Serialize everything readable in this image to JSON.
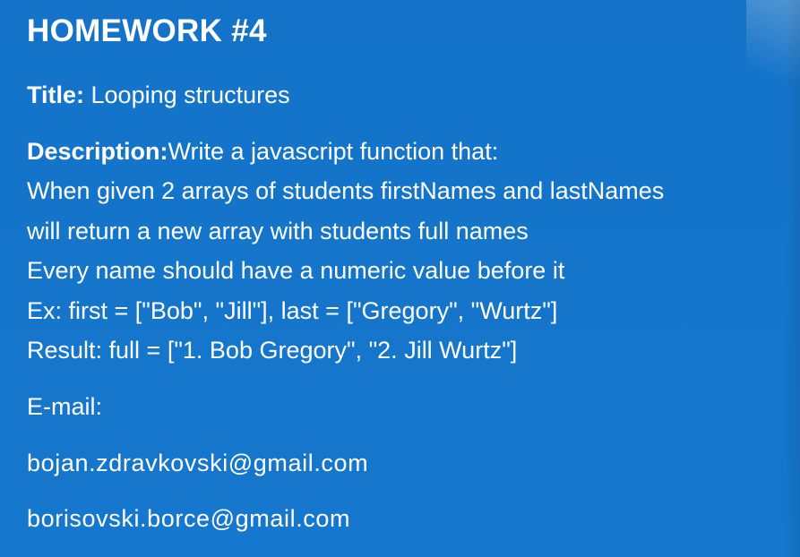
{
  "slide": {
    "heading": "HOMEWORK #4",
    "title_label": "Title:",
    "title_value": " Looping structures",
    "description_label": "Description:",
    "description_value": "Write a javascript function that:",
    "description_lines": [
      "When given 2 arrays of students firstNames and lastNames",
      "will return a new array with students full names",
      "Every name should have a numeric value before it",
      "Ex: first = [\"Bob\", \"Jill\"], last = [\"Gregory\", \"Wurtz\"]",
      "Result: full = [\"1. Bob Gregory\", \"2. Jill Wurtz\"]"
    ],
    "email_label": "E-mail:",
    "emails": [
      "bojan.zdravkovski@gmail.com",
      "borisovski.borce@gmail.com"
    ]
  },
  "colors": {
    "background": "#1473c9",
    "text": "#ffffff"
  }
}
